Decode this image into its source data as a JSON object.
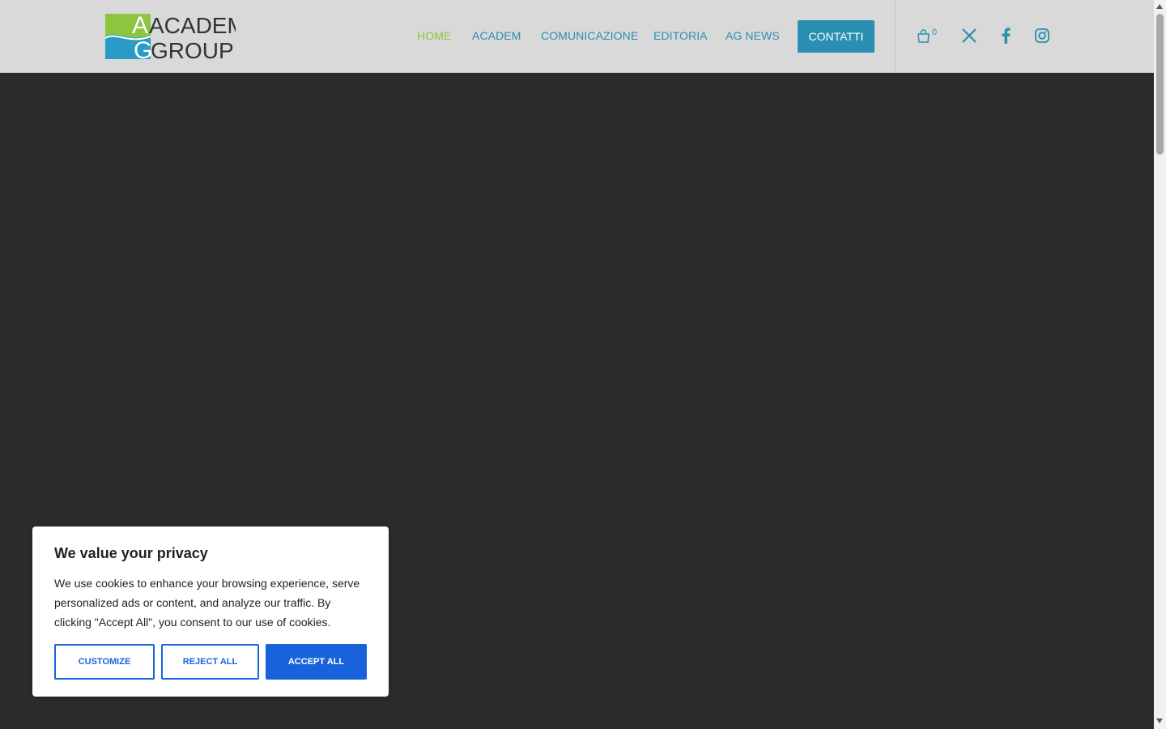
{
  "header": {
    "logo_text_line1": "ACADEM",
    "logo_text_line2": "GROUP",
    "nav": [
      {
        "label": "HOME",
        "active": true
      },
      {
        "label": "ACADEM",
        "active": false
      },
      {
        "label": "COMUNICAZIONE",
        "active": false
      },
      {
        "label": "EDITORIA",
        "active": false
      },
      {
        "label": "AG NEWS",
        "active": false
      }
    ],
    "cta_label": "CONTATTI",
    "cart_count": "0",
    "social_icons": [
      "x-twitter-icon",
      "facebook-icon",
      "instagram-icon"
    ]
  },
  "cookie_banner": {
    "title": "We value your privacy",
    "text": "We use cookies to enhance your browsing experience, serve personalized ads or content, and analyze our traffic. By clicking \"Accept All\", you consent to our use of cookies.",
    "buttons": {
      "customize": "CUSTOMIZE",
      "reject": "REJECT ALL",
      "accept": "ACCEPT ALL"
    }
  },
  "colors": {
    "header_bg": "#d9d9d9",
    "page_bg": "#2b2b2b",
    "nav_link": "#2a8fb0",
    "nav_active": "#8cc63f",
    "cookie_accent": "#1863dc"
  }
}
